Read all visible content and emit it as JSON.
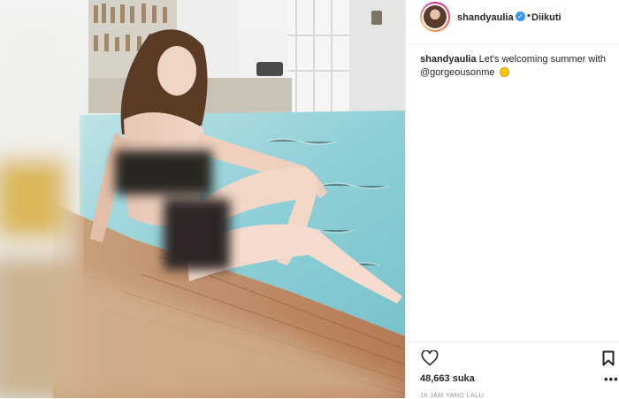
{
  "post": {
    "author": {
      "username": "shandyaulia",
      "verified_icon": "verified-badge-icon",
      "separator": "•",
      "follow_status": "Diikuti",
      "avatar_icon": "avatar-photo"
    },
    "caption": {
      "username": "shandyaulia",
      "text": "Let's welcoming summer with",
      "mention": "@gorgeousonme",
      "emoji_icon": "sun-emoji-icon"
    },
    "actions": {
      "like_icon": "heart-icon",
      "save_icon": "bookmark-icon",
      "more_label": "•••"
    },
    "likes_text": "48,663 suka",
    "timestamp": "16 JAM YANG LALU",
    "photo": {
      "description_icon": "pool-photo"
    },
    "colors": {
      "verified": "#3897f0",
      "text": "#262626",
      "muted": "#999999",
      "divider": "#efefef"
    }
  }
}
